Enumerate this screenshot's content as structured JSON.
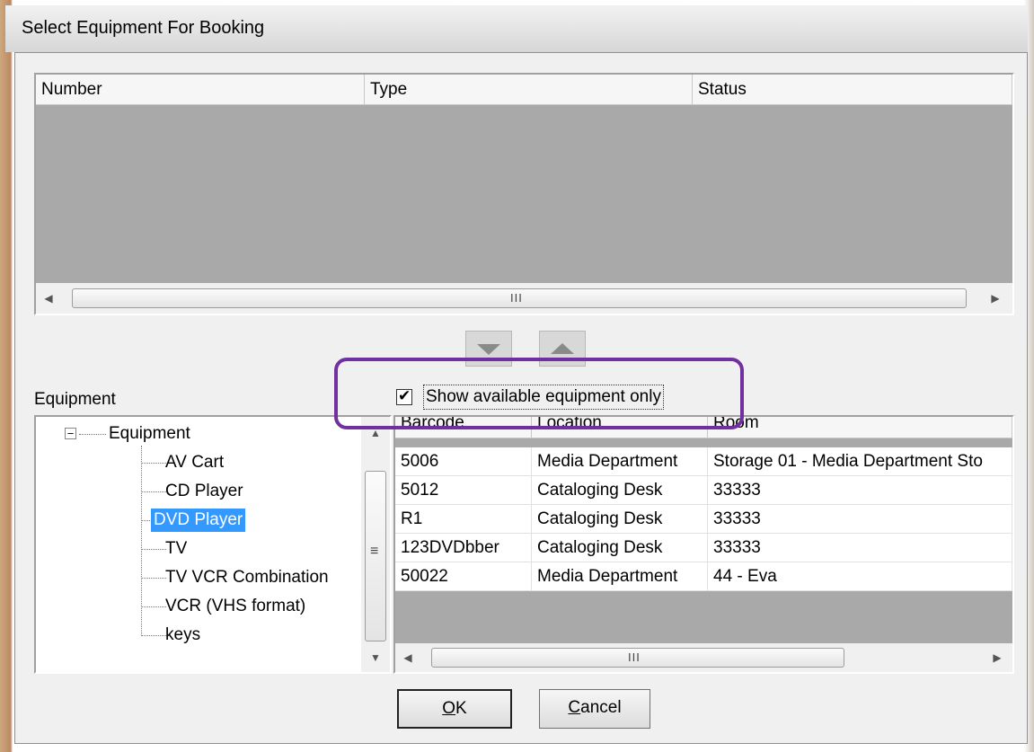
{
  "window": {
    "title": "Select Equipment For Booking"
  },
  "selected_table": {
    "columns": [
      "Number",
      "Type",
      "Status"
    ],
    "rows": [],
    "scroll_grip": "III"
  },
  "move_buttons": {
    "add_icon": "triangle-down-icon",
    "remove_icon": "triangle-up-icon"
  },
  "equipment_label": "Equipment",
  "filter": {
    "label": "Show available equipment only",
    "checked": true,
    "check_glyph": "✔"
  },
  "tree": {
    "root": "Equipment",
    "expander": "−",
    "items": [
      "AV Cart",
      "CD Player",
      "DVD Player",
      "TV",
      "TV VCR Combination",
      "VCR (VHS format)",
      "keys"
    ],
    "selected": "DVD Player",
    "scroll_grip": "≡"
  },
  "available_table": {
    "columns": [
      "Barcode",
      "Location",
      "Room"
    ],
    "rows": [
      [
        "5006",
        "Media Department",
        "Storage 01 - Media Department Sto"
      ],
      [
        "5012",
        "Cataloging Desk",
        "33333"
      ],
      [
        "R1",
        "Cataloging Desk",
        "33333"
      ],
      [
        "123DVDbber",
        "Cataloging Desk",
        "33333"
      ],
      [
        "50022",
        "Media Department",
        "44 - Eva"
      ]
    ],
    "scroll_grip": "III"
  },
  "buttons": {
    "ok": {
      "mnemonic": "O",
      "rest": "K"
    },
    "cancel": {
      "mnemonic": "C",
      "rest": "ancel"
    }
  },
  "colors": {
    "highlight": "#7030a0",
    "selection": "#3399ff",
    "empty_grid": "#a9a9a9"
  }
}
